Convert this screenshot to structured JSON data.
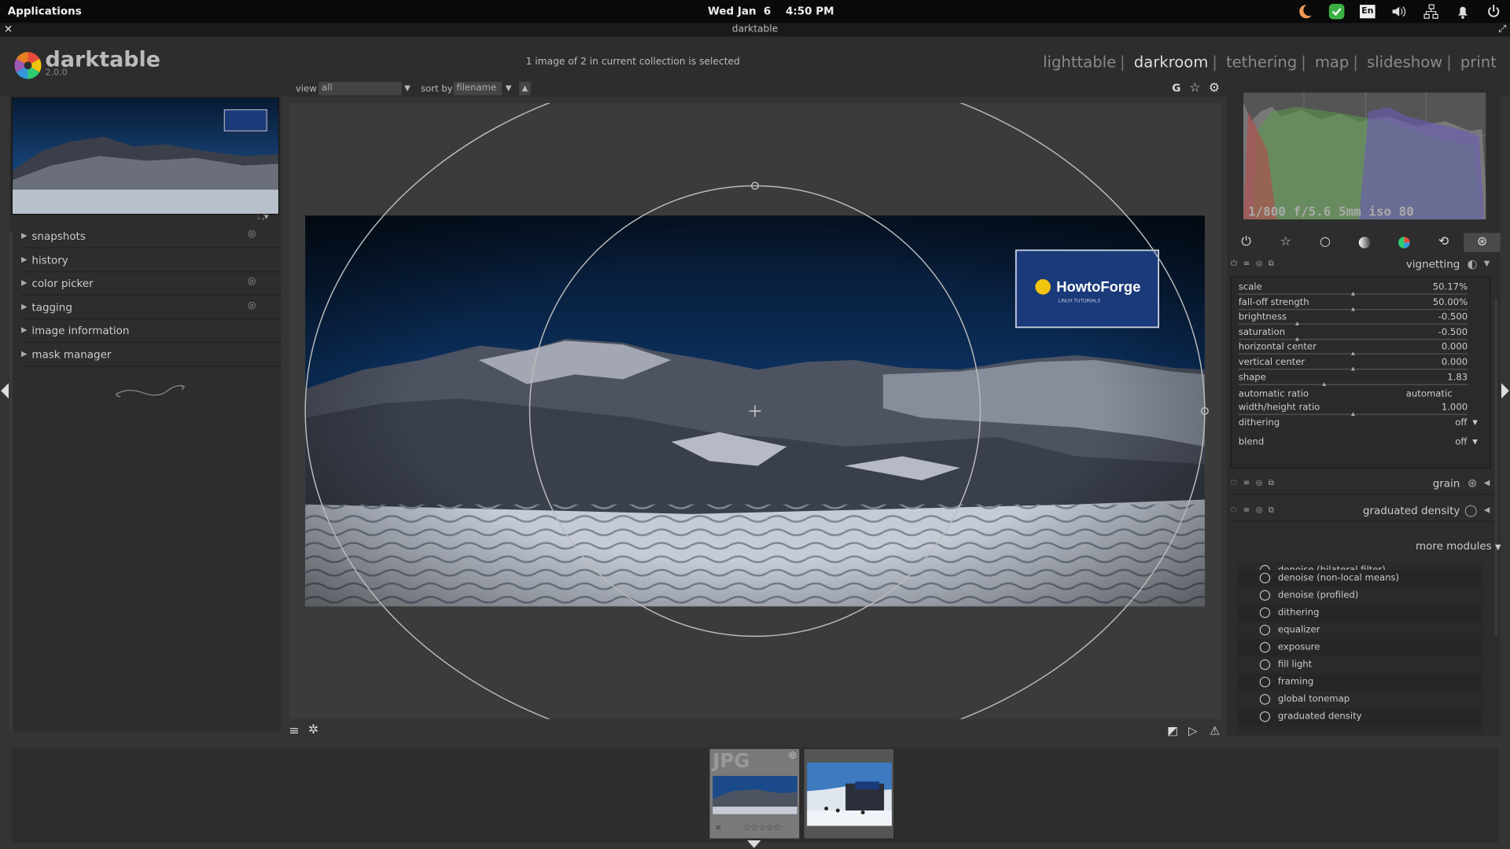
{
  "os_panel": {
    "apps_label": "Applications",
    "clock": "Wed Jan  6    4:50 PM",
    "tray_icons": [
      "redshift-icon",
      "security-check-icon",
      "keyboard-layout-icon",
      "volume-icon",
      "network-icon",
      "notification-icon",
      "power-icon"
    ],
    "keyboard_label": "En"
  },
  "window": {
    "title": "darktable"
  },
  "app": {
    "name": "darktable",
    "version": "2.0.0",
    "status": "1 image of 2 in current collection is selected",
    "views": [
      {
        "label": "lighttable",
        "active": false
      },
      {
        "label": "darkroom",
        "active": true
      },
      {
        "label": "tethering",
        "active": false
      },
      {
        "label": "map",
        "active": false
      },
      {
        "label": "slideshow",
        "active": false
      },
      {
        "label": "print",
        "active": false
      }
    ],
    "view_sep": "|"
  },
  "toolbar": {
    "view_label": "view",
    "view_value": "all",
    "sort_label": "sort by",
    "sort_value": "filename",
    "g_label": "G"
  },
  "left_panel": {
    "modules": [
      {
        "label": "snapshots",
        "has_icon": true
      },
      {
        "label": "history",
        "has_icon": false
      },
      {
        "label": "color picker",
        "has_icon": true
      },
      {
        "label": "tagging",
        "has_icon": true
      },
      {
        "label": "image information",
        "has_icon": false
      },
      {
        "label": "mask manager",
        "has_icon": false
      }
    ]
  },
  "image": {
    "watermark_text": "HowtoForge",
    "watermark_sub": "LINUX TUTORIALS"
  },
  "right_panel": {
    "histogram_info": "1/800 f/5.6 5mm iso 80",
    "vignetting": {
      "title": "vignetting",
      "sliders": [
        {
          "label": "scale",
          "value": "50.17%",
          "pos": 0.5
        },
        {
          "label": "fall-off strength",
          "value": "50.00%",
          "pos": 0.5
        },
        {
          "label": "brightness",
          "value": "-0.500",
          "pos": 0.25
        },
        {
          "label": "saturation",
          "value": "-0.500",
          "pos": 0.25
        },
        {
          "label": "horizontal center",
          "value": "0.000",
          "pos": 0.5
        },
        {
          "label": "vertical center",
          "value": "0.000",
          "pos": 0.5
        },
        {
          "label": "shape",
          "value": "1.83",
          "pos": 0.37
        }
      ],
      "auto_ratio_label": "automatic ratio",
      "auto_ratio_value": "automatic",
      "wh_ratio_label": "width/height ratio",
      "wh_ratio_value": "1.000",
      "wh_ratio_pos": 0.5,
      "dithering_label": "dithering",
      "dithering_value": "off",
      "blend_label": "blend",
      "blend_value": "off"
    },
    "grain_title": "grain",
    "graduated_title": "graduated density",
    "more_modules": "more modules",
    "module_list": [
      "denoise (bilateral filter)",
      "denoise (non-local means)",
      "denoise (profiled)",
      "dithering",
      "equalizer",
      "exposure",
      "fill light",
      "framing",
      "global tonemap",
      "graduated density"
    ]
  },
  "filmstrip": {
    "thumb1_label": "JPG",
    "thumb1_stars": "☆☆☆☆☆"
  },
  "colors": {
    "accent": "#1a3a7a",
    "bg": "#343434",
    "panel": "#2d2d2d"
  }
}
